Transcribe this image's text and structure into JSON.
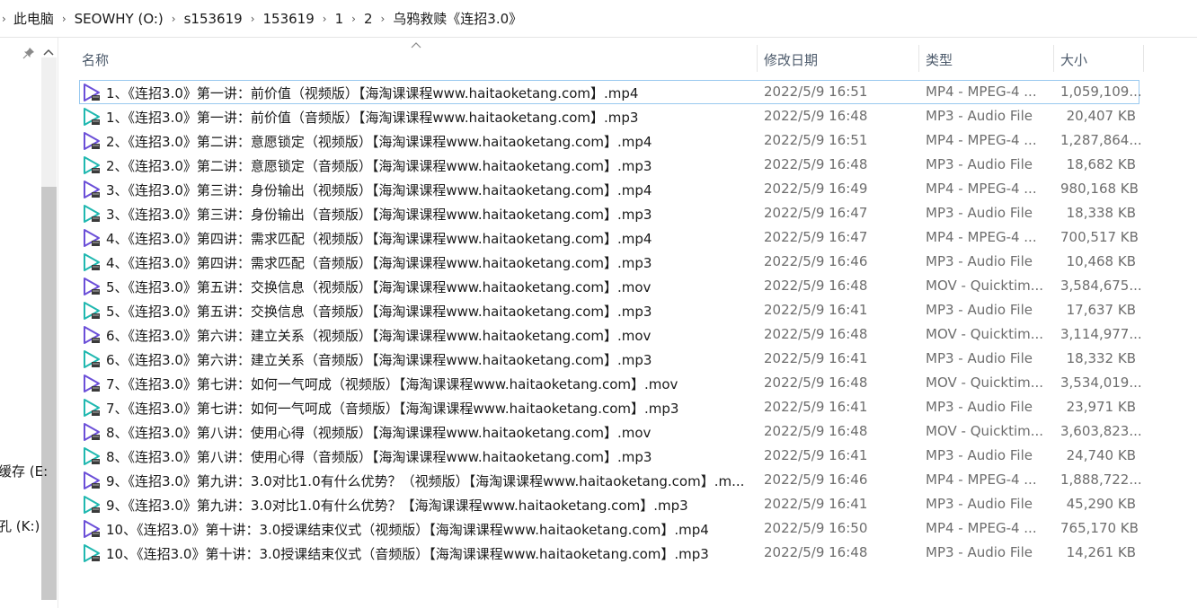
{
  "breadcrumb": [
    "此电脑",
    "SEOWHY (O:)",
    "s153619",
    "153619",
    "1",
    "2",
    "乌鸦救赎《连招3.0》"
  ],
  "nav_fragments": [
    "缓存 (E:",
    "孔 (K:)"
  ],
  "columns": {
    "name": "名称",
    "date": "修改日期",
    "type": "类型",
    "size": "大小"
  },
  "files": [
    {
      "name": "1、《连招3.0》第一讲：前价值（视频版）【海淘课课程www.haitaoketang.com】.mp4",
      "date": "2022/5/9 16:51",
      "type": "MP4 - MPEG-4 ...",
      "size": "1,059,109...",
      "kind": "video"
    },
    {
      "name": "1、《连招3.0》第一讲：前价值（音频版）【海淘课课程www.haitaoketang.com】.mp3",
      "date": "2022/5/9 16:48",
      "type": "MP3 - Audio File",
      "size": "20,407 KB",
      "kind": "audio"
    },
    {
      "name": "2、《连招3.0》第二讲：意愿锁定（视频版）【海淘课课程www.haitaoketang.com】.mp4",
      "date": "2022/5/9 16:51",
      "type": "MP4 - MPEG-4 ...",
      "size": "1,287,864...",
      "kind": "video"
    },
    {
      "name": "2、《连招3.0》第二讲：意愿锁定（音频版）【海淘课课程www.haitaoketang.com】.mp3",
      "date": "2022/5/9 16:48",
      "type": "MP3 - Audio File",
      "size": "18,682 KB",
      "kind": "audio"
    },
    {
      "name": "3、《连招3.0》第三讲：身份输出（视频版）【海淘课课程www.haitaoketang.com】.mp4",
      "date": "2022/5/9 16:49",
      "type": "MP4 - MPEG-4 ...",
      "size": "980,168 KB",
      "kind": "video"
    },
    {
      "name": "3、《连招3.0》第三讲：身份输出（音频版）【海淘课课程www.haitaoketang.com】.mp3",
      "date": "2022/5/9 16:47",
      "type": "MP3 - Audio File",
      "size": "18,338 KB",
      "kind": "audio"
    },
    {
      "name": "4、《连招3.0》第四讲：需求匹配（视频版）【海淘课课程www.haitaoketang.com】.mp4",
      "date": "2022/5/9 16:47",
      "type": "MP4 - MPEG-4 ...",
      "size": "700,517 KB",
      "kind": "video"
    },
    {
      "name": "4、《连招3.0》第四讲：需求匹配（音频版）【海淘课课程www.haitaoketang.com】.mp3",
      "date": "2022/5/9 16:46",
      "type": "MP3 - Audio File",
      "size": "10,468 KB",
      "kind": "audio"
    },
    {
      "name": "5、《连招3.0》第五讲：交换信息（视频版）【海淘课课程www.haitaoketang.com】.mov",
      "date": "2022/5/9 16:48",
      "type": "MOV - Quicktim...",
      "size": "3,584,675...",
      "kind": "video"
    },
    {
      "name": "5、《连招3.0》第五讲：交换信息（音频版）【海淘课课程www.haitaoketang.com】.mp3",
      "date": "2022/5/9 16:41",
      "type": "MP3 - Audio File",
      "size": "17,637 KB",
      "kind": "audio"
    },
    {
      "name": "6、《连招3.0》第六讲：建立关系（视频版）【海淘课课程www.haitaoketang.com】.mov",
      "date": "2022/5/9 16:48",
      "type": "MOV - Quicktim...",
      "size": "3,114,977...",
      "kind": "video"
    },
    {
      "name": "6、《连招3.0》第六讲：建立关系（音频版）【海淘课课程www.haitaoketang.com】.mp3",
      "date": "2022/5/9 16:41",
      "type": "MP3 - Audio File",
      "size": "18,332 KB",
      "kind": "audio"
    },
    {
      "name": "7、《连招3.0》第七讲：如何一气呵成（视频版）【海淘课课程www.haitaoketang.com】.mov",
      "date": "2022/5/9 16:48",
      "type": "MOV - Quicktim...",
      "size": "3,534,019...",
      "kind": "video"
    },
    {
      "name": "7、《连招3.0》第七讲：如何一气呵成（音频版）【海淘课课程www.haitaoketang.com】.mp3",
      "date": "2022/5/9 16:41",
      "type": "MP3 - Audio File",
      "size": "23,971 KB",
      "kind": "audio"
    },
    {
      "name": "8、《连招3.0》第八讲：使用心得（视频版）【海淘课课程www.haitaoketang.com】.mov",
      "date": "2022/5/9 16:48",
      "type": "MOV - Quicktim...",
      "size": "3,603,823...",
      "kind": "video"
    },
    {
      "name": "8、《连招3.0》第八讲：使用心得（音频版）【海淘课课程www.haitaoketang.com】.mp3",
      "date": "2022/5/9 16:41",
      "type": "MP3 - Audio File",
      "size": "24,740 KB",
      "kind": "audio"
    },
    {
      "name": "9、《连招3.0》第九讲：3.0对比1.0有什么优势？（视频版）【海淘课课程www.haitaoketang.com】.m...",
      "date": "2022/5/9 16:46",
      "type": "MP4 - MPEG-4 ...",
      "size": "1,888,722...",
      "kind": "video"
    },
    {
      "name": "9、《连招3.0》第九讲：3.0对比1.0有什么优势？【海淘课课程www.haitaoketang.com】.mp3",
      "date": "2022/5/9 16:41",
      "type": "MP3 - Audio File",
      "size": "45,290 KB",
      "kind": "audio"
    },
    {
      "name": "10、《连招3.0》第十讲：3.0授课结束仪式（视频版）【海淘课课程www.haitaoketang.com】.mp4",
      "date": "2022/5/9 16:50",
      "type": "MP4 - MPEG-4 ...",
      "size": "765,170 KB",
      "kind": "video"
    },
    {
      "name": "10、《连招3.0》第十讲：3.0授课结束仪式（音频版）【海淘课课程www.haitaoketang.com】.mp3",
      "date": "2022/5/9 16:48",
      "type": "MP3 - Audio File",
      "size": "14,261 KB",
      "kind": "audio"
    }
  ],
  "colors": {
    "video_icon": "#6b4fd8",
    "audio_icon": "#20b8b0",
    "selection_border": "#99c9ef",
    "header_text": "#4c5a6b",
    "meta_text": "#6d6d6d"
  }
}
